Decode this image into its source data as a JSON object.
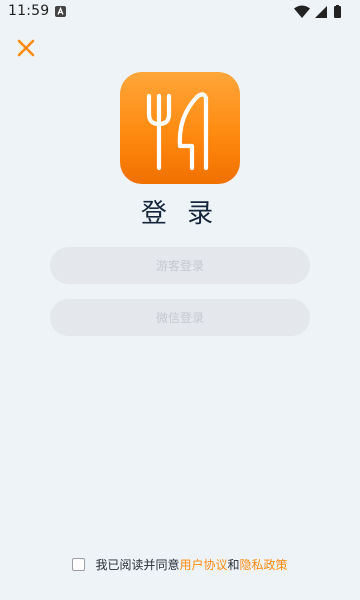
{
  "status_bar": {
    "time": "11:59",
    "notification_icon": "a-icon",
    "wifi_icon": "wifi-icon",
    "signal_icon": "signal-icon",
    "battery_icon": "battery-icon"
  },
  "header": {
    "close_icon": "close-icon",
    "accent_color": "#ff8a10"
  },
  "logo": {
    "icon": "fork-knife-icon",
    "gradient_top": "#ffa63a",
    "gradient_bottom": "#f07000"
  },
  "title": "登 录",
  "buttons": {
    "guest_login": "游客登录",
    "wechat_login": "微信登录"
  },
  "agreement": {
    "prefix": "我已阅读并同意",
    "user_agreement": "用户协议",
    "conjunction": "和",
    "privacy_policy": "隐私政策",
    "checked": false
  }
}
